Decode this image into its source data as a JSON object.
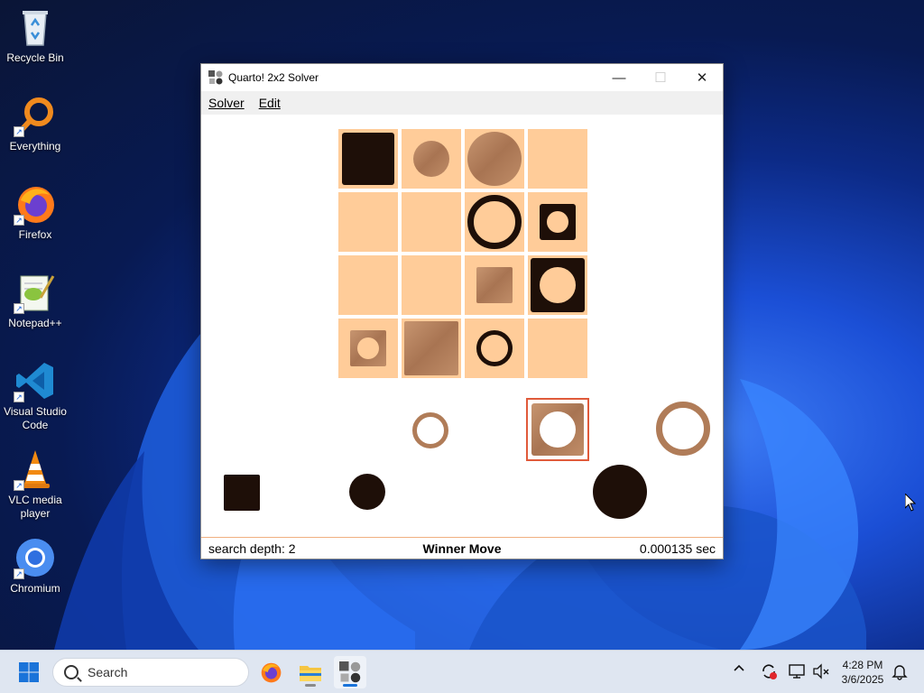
{
  "desktop": {
    "icons": [
      {
        "label": "Recycle Bin"
      },
      {
        "label": "Everything"
      },
      {
        "label": "Firefox"
      },
      {
        "label": "Notepad++"
      },
      {
        "label": "Visual Studio Code"
      },
      {
        "label": "VLC media player"
      },
      {
        "label": "Chromium"
      }
    ]
  },
  "window": {
    "title": "Quarto! 2x2 Solver",
    "controls": {
      "minimize": "—",
      "maximize": "☐",
      "close": "✕"
    },
    "menu": [
      {
        "label": "Solver",
        "accel": "S"
      },
      {
        "label": "Edit",
        "accel": "E"
      }
    ],
    "status": {
      "depth": "search depth: 2",
      "message": "Winner Move",
      "time": "0.000135 sec"
    }
  },
  "colors": {
    "board_cell": "#ffcc99",
    "dark_piece": "#1e0f08",
    "light_piece": "#b07c58",
    "selection": "#e05a3a",
    "status_border": "#f0b080"
  },
  "taskbar": {
    "search_placeholder": "Search",
    "apps": [
      {
        "name": "firefox-icon"
      },
      {
        "name": "file-explorer-icon"
      },
      {
        "name": "quarto-solver-icon"
      }
    ],
    "tray": {
      "chevron": "^"
    },
    "clock": {
      "time": "4:28 PM",
      "date": "3/6/2025"
    }
  }
}
